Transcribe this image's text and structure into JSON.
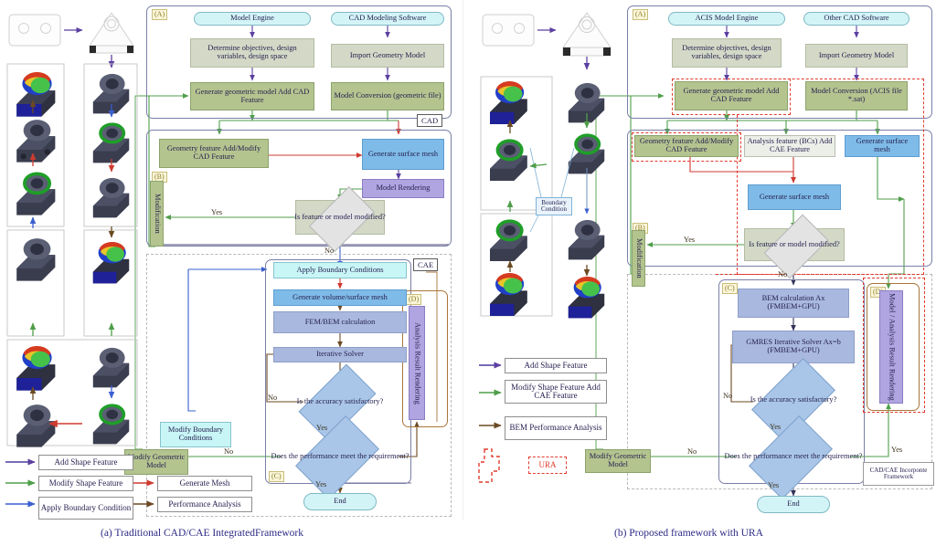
{
  "figure": {
    "caption_a": "(a) Traditional CAD/CAE IntegratedFramework",
    "caption_b": "(b) Proposed framework with URA"
  },
  "panel_a": {
    "regions": {
      "A": "(A)",
      "B": "(B)",
      "C": "(C)",
      "D": "(D)",
      "cad_label": "CAD",
      "cae_label": "CAE"
    },
    "nodes": {
      "model_engine": "Model Engine",
      "cad_software": "CAD Modeling Software",
      "determine_objectives": "Determine objectives, design variables, design space",
      "import_geometry": "Import Geometry Model",
      "generate_geometric_model": "Generate geometric model Add CAD Feature",
      "model_conversion": "Model Conversion (geometric file)",
      "geometry_feature": "Geometry feature Add/Modify CAD Feature",
      "generate_surface_mesh": "Generate surface mesh",
      "model_rendering": "Model Rendering",
      "modification": "Modification",
      "is_feature_modified": "Is feature or model modified?",
      "apply_bc": "Apply Boundary Conditions",
      "generate_volume_mesh": "Generate volume/surface mesh",
      "fem_bem": "FEM/BEM calculation",
      "iterative_solver": "Iterative Solver",
      "accuracy": "Is the accuracy satisfactory?",
      "performance": "Does the performance meet the requirement?",
      "modify_bc": "Modify Boundary Conditions",
      "modify_geometric_model": "Modify Geometric Model",
      "analysis_result_rendering": "Analysis Result Rendering",
      "end": "End"
    },
    "edge_labels": {
      "yes_modified": "Yes",
      "no_modified": "No",
      "no_accuracy": "No",
      "yes_accuracy": "Yes",
      "no_performance": "No",
      "yes_performance": "Yes"
    },
    "legend": [
      {
        "label": "Add Shape Feature",
        "color": "#4a3a9e"
      },
      {
        "label": "Modify Shape Feature",
        "color": "#4f9e4a"
      },
      {
        "label": "Apply Boundary Condition",
        "color": "#3a5fd0"
      },
      {
        "label": "Generate Mesh",
        "color": "#e03b2e"
      },
      {
        "label": "Performance Analysis",
        "color": "#6b4a22"
      }
    ]
  },
  "panel_b": {
    "regions": {
      "A": "(A)",
      "B": "(B)",
      "C": "(C)",
      "D": "(D)",
      "framework_label": "CAD/CAE Incorponte Framework"
    },
    "nodes": {
      "acis_engine": "ACIS Model Engine",
      "other_cad": "Other CAD Software",
      "determine_objectives": "Determine objectives, design variables, design space",
      "import_geometry": "Import Geometry Model",
      "generate_geometric_model": "Generate geometric model Add CAD Feature",
      "model_conversion": "Model Conversion (ACIS file  *.sat)",
      "geometry_feature": "Geometry feature Add/Modify CAD Feature",
      "analysis_feature": "Analysis feature (BCs) Add CAE Feature",
      "generate_surface_mesh_top": "Generate surface mesh",
      "generate_surface_mesh_mid": "Generate surface mesh",
      "modification": "Modification",
      "is_feature_modified": "Is feature or model modified?",
      "bem_calculation": "BEM calculation Ax (FMBEM+GPU)",
      "gmres_solver": "GMRES Iterative Solver Ax=b (FMBEM+GPU)",
      "accuracy": "Is the accuracy satisfactory?",
      "performance": "Does the performance meet the requirement?",
      "modify_geometric_model": "Modify Geometric Model",
      "model_analysis_rendering": "Model / Analysis Result Rendering",
      "end": "End",
      "boundary_condition": "Boundary Condition"
    },
    "edge_labels": {
      "yes_modified": "Yes",
      "no_modified": "No",
      "no_accuracy": "No",
      "yes_accuracy": "Yes",
      "no_performance": "No",
      "yes_performance": "Yes",
      "yes_render": "Yes"
    },
    "legend": [
      {
        "label": "Add Shape Feature",
        "color": "#4a3a9e"
      },
      {
        "label": "Modify Shape Feature Add CAE Feature",
        "color": "#4f9e4a"
      },
      {
        "label": "BEM Performance Analysis",
        "color": "#6b4a22"
      },
      {
        "label": "URA",
        "color": "#e03b2e"
      }
    ]
  },
  "colors": {
    "green_box": "#b3c48f",
    "grey_box": "#d3d9c6",
    "blue_box": "#7fbbe8",
    "blue_light": "#a9b8de",
    "cyan_box": "#c8f5f6",
    "purple_box": "#b0a5e0",
    "diamond_blue": "#a9c6e8",
    "diamond_grey": "#e3e3e3",
    "ura_red": "#e03b2e",
    "caption_color": "#2d2a86"
  }
}
